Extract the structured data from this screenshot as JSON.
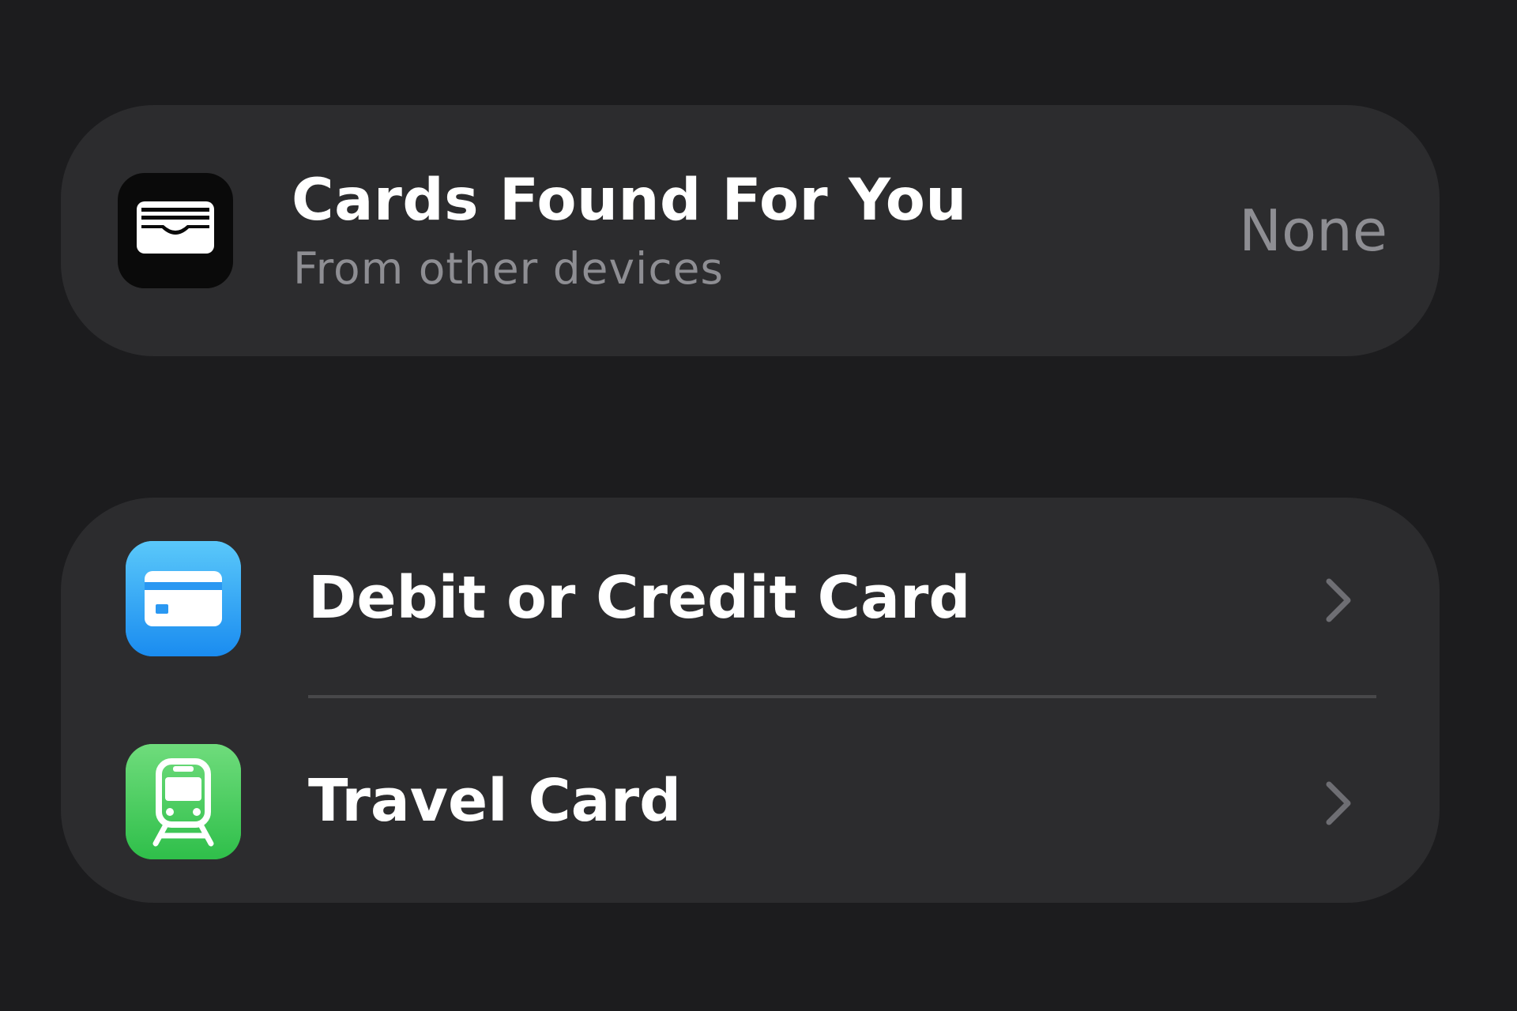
{
  "cards_found": {
    "title": "Cards Found For You",
    "subtitle": "From other devices",
    "value": "None",
    "icon": "wallet-icon"
  },
  "add_options": [
    {
      "label": "Debit or Credit Card",
      "icon": "credit-card-icon",
      "accessory": "chevron-right-icon"
    },
    {
      "label": "Travel Card",
      "icon": "train-icon",
      "accessory": "chevron-right-icon"
    }
  ],
  "colors": {
    "background": "#1c1c1e",
    "group_background": "#2c2c2e",
    "primary_text": "#ffffff",
    "secondary_text": "#8e8e93",
    "card_icon_blue": "#1a8cf0",
    "train_icon_green": "#2fbf4a"
  }
}
